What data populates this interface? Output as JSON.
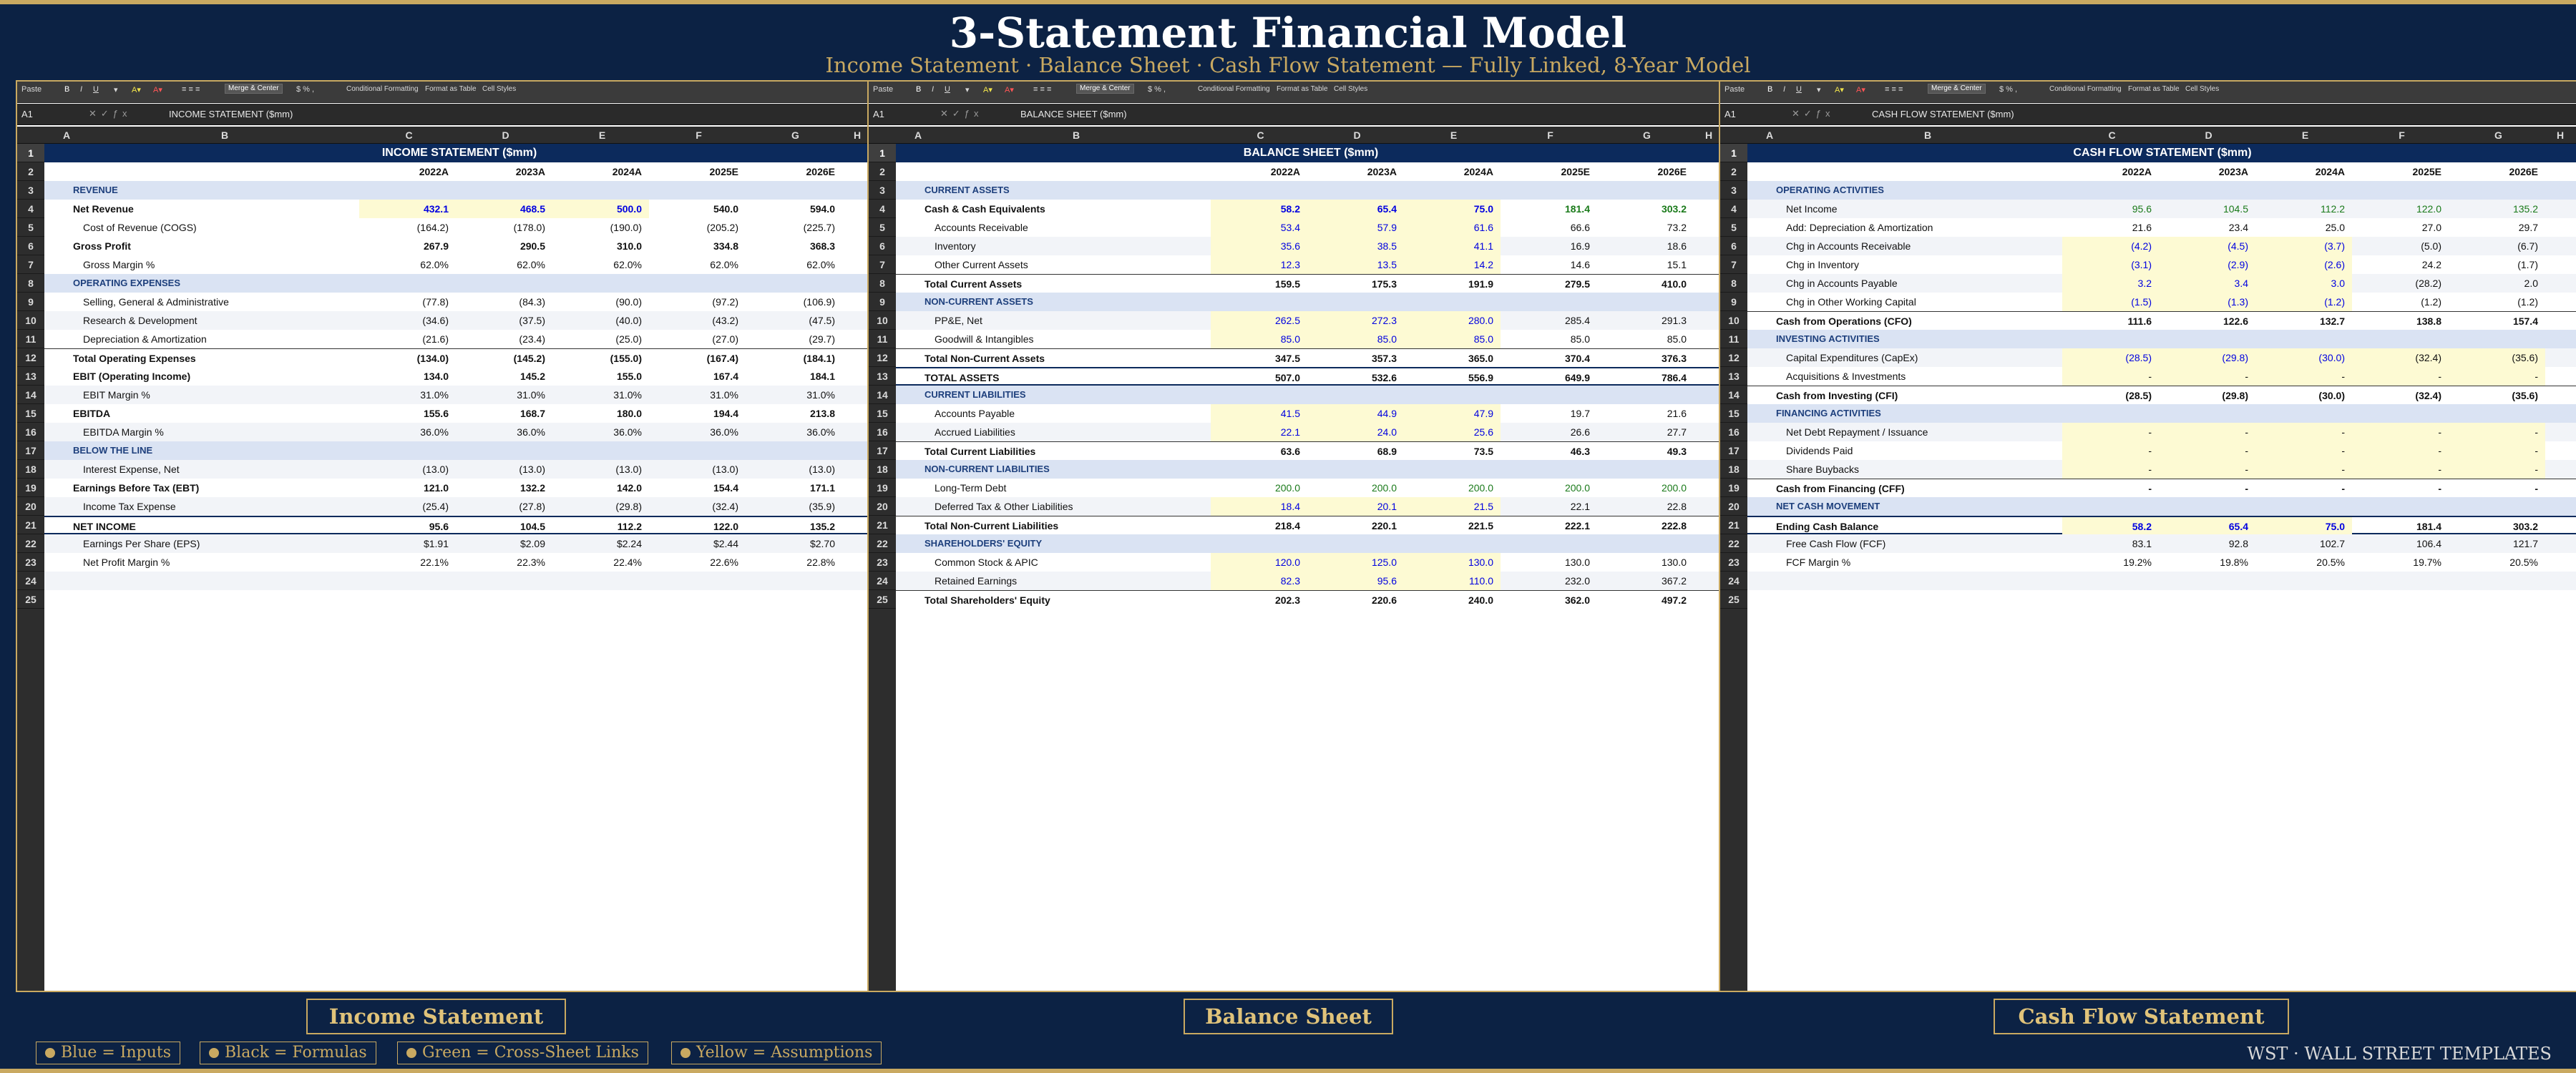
{
  "header": {
    "title": "3-Statement Financial Model",
    "subtitle": "Income Statement  ·  Balance Sheet  ·  Cash Flow Statement  —  Fully Linked, 8-Year Model"
  },
  "ribbon": {
    "paste": "Paste",
    "merge": "Merge & Center",
    "conditional": "Conditional Formatting",
    "format_table": "Format as Table",
    "cell_styles": "Cell Styles"
  },
  "columns": [
    "A",
    "B",
    "C",
    "D",
    "E",
    "F",
    "G"
  ],
  "years": [
    "2022A",
    "2023A",
    "2024A",
    "2025E",
    "2026E"
  ],
  "panels": [
    {
      "cell_ref": "A1",
      "formula": "INCOME STATEMENT ($mm)",
      "sheet_title": "INCOME STATEMENT ($mm)",
      "next_col": "H",
      "rows": [
        {
          "t": "sec",
          "label": "REVENUE"
        },
        {
          "t": "bold",
          "label": "Net Revenue",
          "vals": [
            "432.1",
            "468.5",
            "500.0",
            "540.0",
            "594.0"
          ],
          "c": [
            "inp",
            "inp",
            "inp",
            "",
            ""
          ],
          "y": [
            1,
            1,
            1,
            0,
            0
          ]
        },
        {
          "t": "ind",
          "label": "Cost of Revenue (COGS)",
          "vals": [
            "(164.2)",
            "(178.0)",
            "(190.0)",
            "(205.2)",
            "(225.7)"
          ]
        },
        {
          "t": "bold",
          "label": "Gross Profit",
          "vals": [
            "267.9",
            "290.5",
            "310.0",
            "334.8",
            "368.3"
          ]
        },
        {
          "t": "ind",
          "label": "Gross Margin %",
          "vals": [
            "62.0%",
            "62.0%",
            "62.0%",
            "62.0%",
            "62.0%"
          ]
        },
        {
          "t": "sec",
          "label": "OPERATING EXPENSES"
        },
        {
          "t": "ind",
          "label": "Selling, General & Administrative",
          "vals": [
            "(77.8)",
            "(84.3)",
            "(90.0)",
            "(97.2)",
            "(106.9)"
          ]
        },
        {
          "t": "ind",
          "label": "Research & Development",
          "vals": [
            "(34.6)",
            "(37.5)",
            "(40.0)",
            "(43.2)",
            "(47.5)"
          ]
        },
        {
          "t": "ind",
          "label": "Depreciation & Amortization",
          "vals": [
            "(21.6)",
            "(23.4)",
            "(25.0)",
            "(27.0)",
            "(29.7)"
          ]
        },
        {
          "t": "tot",
          "label": "Total Operating Expenses",
          "vals": [
            "(134.0)",
            "(145.2)",
            "(155.0)",
            "(167.4)",
            "(184.1)"
          ]
        },
        {
          "t": "bold",
          "label": "EBIT (Operating Income)",
          "vals": [
            "134.0",
            "145.2",
            "155.0",
            "167.4",
            "184.1"
          ]
        },
        {
          "t": "ind",
          "label": "EBIT Margin %",
          "vals": [
            "31.0%",
            "31.0%",
            "31.0%",
            "31.0%",
            "31.0%"
          ]
        },
        {
          "t": "bold",
          "label": "EBITDA",
          "vals": [
            "155.6",
            "168.7",
            "180.0",
            "194.4",
            "213.8"
          ]
        },
        {
          "t": "ind",
          "label": "EBITDA Margin %",
          "vals": [
            "36.0%",
            "36.0%",
            "36.0%",
            "36.0%",
            "36.0%"
          ]
        },
        {
          "t": "sec",
          "label": "BELOW THE LINE"
        },
        {
          "t": "ind",
          "label": "Interest Expense, Net",
          "vals": [
            "(13.0)",
            "(13.0)",
            "(13.0)",
            "(13.0)",
            "(13.0)"
          ]
        },
        {
          "t": "bold",
          "label": "Earnings Before Tax (EBT)",
          "vals": [
            "121.0",
            "132.2",
            "142.0",
            "154.4",
            "171.1"
          ]
        },
        {
          "t": "ind",
          "label": "Income Tax Expense",
          "vals": [
            "(25.4)",
            "(27.8)",
            "(29.8)",
            "(32.4)",
            "(35.9)"
          ]
        },
        {
          "t": "grand",
          "label": "NET INCOME",
          "vals": [
            "95.6",
            "104.5",
            "112.2",
            "122.0",
            "135.2"
          ]
        },
        {
          "t": "ind",
          "label": "Earnings Per Share (EPS)",
          "vals": [
            "$1.91",
            "$2.09",
            "$2.24",
            "$2.44",
            "$2.70"
          ]
        },
        {
          "t": "ind",
          "label": "Net Profit Margin %",
          "vals": [
            "22.1%",
            "22.3%",
            "22.4%",
            "22.6%",
            "22.8%"
          ]
        },
        {
          "t": "blank",
          "label": ""
        },
        {
          "t": "blank",
          "label": ""
        }
      ]
    },
    {
      "cell_ref": "A1",
      "formula": "BALANCE SHEET ($mm)",
      "sheet_title": "BALANCE SHEET ($mm)",
      "next_col": "H",
      "rows": [
        {
          "t": "sec",
          "label": "CURRENT ASSETS"
        },
        {
          "t": "bold",
          "label": "Cash & Cash Equivalents",
          "vals": [
            "58.2",
            "65.4",
            "75.0",
            "181.4",
            "303.2"
          ],
          "c": [
            "inp",
            "inp",
            "inp",
            "lnk",
            "lnk"
          ],
          "y": [
            1,
            1,
            1,
            0,
            0
          ]
        },
        {
          "t": "ind",
          "label": "Accounts Receivable",
          "vals": [
            "53.4",
            "57.9",
            "61.6",
            "66.6",
            "73.2"
          ],
          "c": [
            "inp",
            "inp",
            "inp",
            "",
            ""
          ],
          "y": [
            1,
            1,
            1,
            0,
            0
          ]
        },
        {
          "t": "ind",
          "label": "Inventory",
          "vals": [
            "35.6",
            "38.5",
            "41.1",
            "16.9",
            "18.6"
          ],
          "c": [
            "inp",
            "inp",
            "inp",
            "",
            ""
          ],
          "y": [
            1,
            1,
            1,
            0,
            0
          ]
        },
        {
          "t": "ind",
          "label": "Other Current Assets",
          "vals": [
            "12.3",
            "13.5",
            "14.2",
            "14.6",
            "15.1"
          ],
          "c": [
            "inp",
            "inp",
            "inp",
            "",
            ""
          ],
          "y": [
            1,
            1,
            1,
            0,
            0
          ]
        },
        {
          "t": "tot",
          "label": "Total Current Assets",
          "vals": [
            "159.5",
            "175.3",
            "191.9",
            "279.5",
            "410.0"
          ]
        },
        {
          "t": "sec",
          "label": "NON-CURRENT ASSETS"
        },
        {
          "t": "ind",
          "label": "PP&E, Net",
          "vals": [
            "262.5",
            "272.3",
            "280.0",
            "285.4",
            "291.3"
          ],
          "c": [
            "inp",
            "inp",
            "inp",
            "",
            ""
          ],
          "y": [
            1,
            1,
            1,
            0,
            0
          ]
        },
        {
          "t": "ind",
          "label": "Goodwill & Intangibles",
          "vals": [
            "85.0",
            "85.0",
            "85.0",
            "85.0",
            "85.0"
          ],
          "c": [
            "inp",
            "inp",
            "inp",
            "",
            ""
          ],
          "y": [
            1,
            1,
            1,
            0,
            0
          ]
        },
        {
          "t": "tot",
          "label": "Total Non-Current Assets",
          "vals": [
            "347.5",
            "357.3",
            "365.0",
            "370.4",
            "376.3"
          ]
        },
        {
          "t": "grand",
          "label": "TOTAL ASSETS",
          "vals": [
            "507.0",
            "532.6",
            "556.9",
            "649.9",
            "786.4"
          ]
        },
        {
          "t": "sec",
          "label": "CURRENT LIABILITIES"
        },
        {
          "t": "ind",
          "label": "Accounts Payable",
          "vals": [
            "41.5",
            "44.9",
            "47.9",
            "19.7",
            "21.6"
          ],
          "c": [
            "inp",
            "inp",
            "inp",
            "",
            ""
          ],
          "y": [
            1,
            1,
            1,
            0,
            0
          ]
        },
        {
          "t": "ind",
          "label": "Accrued Liabilities",
          "vals": [
            "22.1",
            "24.0",
            "25.6",
            "26.6",
            "27.7"
          ],
          "c": [
            "inp",
            "inp",
            "inp",
            "",
            ""
          ],
          "y": [
            1,
            1,
            1,
            0,
            0
          ]
        },
        {
          "t": "tot",
          "label": "Total Current Liabilities",
          "vals": [
            "63.6",
            "68.9",
            "73.5",
            "46.3",
            "49.3"
          ]
        },
        {
          "t": "sec",
          "label": "NON-CURRENT LIABILITIES"
        },
        {
          "t": "ind",
          "label": "Long-Term Debt",
          "vals": [
            "200.0",
            "200.0",
            "200.0",
            "200.0",
            "200.0"
          ],
          "c": [
            "lnk",
            "lnk",
            "lnk",
            "lnk",
            "lnk"
          ]
        },
        {
          "t": "ind",
          "label": "Deferred Tax & Other Liabilities",
          "vals": [
            "18.4",
            "20.1",
            "21.5",
            "22.1",
            "22.8"
          ],
          "c": [
            "inp",
            "inp",
            "inp",
            "",
            ""
          ],
          "y": [
            1,
            1,
            1,
            0,
            0
          ]
        },
        {
          "t": "tot",
          "label": "Total Non-Current Liabilities",
          "vals": [
            "218.4",
            "220.1",
            "221.5",
            "222.1",
            "222.8"
          ]
        },
        {
          "t": "sec",
          "label": "SHAREHOLDERS' EQUITY"
        },
        {
          "t": "ind",
          "label": "Common Stock & APIC",
          "vals": [
            "120.0",
            "125.0",
            "130.0",
            "130.0",
            "130.0"
          ],
          "c": [
            "inp",
            "inp",
            "inp",
            "",
            ""
          ],
          "y": [
            1,
            1,
            1,
            0,
            0
          ]
        },
        {
          "t": "ind",
          "label": "Retained Earnings",
          "vals": [
            "82.3",
            "95.6",
            "110.0",
            "232.0",
            "367.2"
          ],
          "c": [
            "inp",
            "inp",
            "inp",
            "",
            ""
          ],
          "y": [
            1,
            1,
            1,
            0,
            0
          ]
        },
        {
          "t": "tot",
          "label": "Total Shareholders' Equity",
          "vals": [
            "202.3",
            "220.6",
            "240.0",
            "362.0",
            "497.2"
          ]
        }
      ]
    },
    {
      "cell_ref": "A1",
      "formula": "CASH FLOW STATEMENT ($mm)",
      "sheet_title": "CASH FLOW STATEMENT ($mm)",
      "next_col": "H",
      "rows": [
        {
          "t": "sec",
          "label": "OPERATING ACTIVITIES"
        },
        {
          "t": "ind",
          "label": "Net Income",
          "vals": [
            "95.6",
            "104.5",
            "112.2",
            "122.0",
            "135.2"
          ],
          "c": [
            "lnk",
            "lnk",
            "lnk",
            "lnk",
            "lnk"
          ]
        },
        {
          "t": "ind",
          "label": "Add: Depreciation & Amortization",
          "vals": [
            "21.6",
            "23.4",
            "25.0",
            "27.0",
            "29.7"
          ]
        },
        {
          "t": "ind",
          "label": "Chg in Accounts Receivable",
          "vals": [
            "(4.2)",
            "(4.5)",
            "(3.7)",
            "(5.0)",
            "(6.7)"
          ],
          "c": [
            "inp",
            "inp",
            "inp",
            "",
            ""
          ],
          "y": [
            1,
            1,
            1,
            0,
            0
          ]
        },
        {
          "t": "ind",
          "label": "Chg in Inventory",
          "vals": [
            "(3.1)",
            "(2.9)",
            "(2.6)",
            "24.2",
            "(1.7)"
          ],
          "c": [
            "inp",
            "inp",
            "inp",
            "",
            ""
          ],
          "y": [
            1,
            1,
            1,
            0,
            0
          ]
        },
        {
          "t": "ind",
          "label": "Chg in Accounts Payable",
          "vals": [
            "3.2",
            "3.4",
            "3.0",
            "(28.2)",
            "2.0"
          ],
          "c": [
            "inp",
            "inp",
            "inp",
            "",
            ""
          ],
          "y": [
            1,
            1,
            1,
            0,
            0
          ]
        },
        {
          "t": "ind",
          "label": "Chg in Other Working Capital",
          "vals": [
            "(1.5)",
            "(1.3)",
            "(1.2)",
            "(1.2)",
            "(1.2)"
          ],
          "c": [
            "inp",
            "inp",
            "inp",
            "",
            ""
          ],
          "y": [
            1,
            1,
            1,
            0,
            0
          ]
        },
        {
          "t": "tot",
          "label": "Cash from Operations (CFO)",
          "vals": [
            "111.6",
            "122.6",
            "132.7",
            "138.8",
            "157.4"
          ]
        },
        {
          "t": "sec",
          "label": "INVESTING ACTIVITIES"
        },
        {
          "t": "ind",
          "label": "Capital Expenditures (CapEx)",
          "vals": [
            "(28.5)",
            "(29.8)",
            "(30.0)",
            "(32.4)",
            "(35.6)"
          ],
          "c": [
            "inp",
            "inp",
            "inp",
            "",
            ""
          ],
          "y": [
            1,
            1,
            1,
            1,
            1
          ]
        },
        {
          "t": "ind",
          "label": "Acquisitions & Investments",
          "vals": [
            "-",
            "-",
            "-",
            "-",
            "-"
          ],
          "y": [
            1,
            1,
            1,
            1,
            1
          ]
        },
        {
          "t": "tot",
          "label": "Cash from Investing (CFI)",
          "vals": [
            "(28.5)",
            "(29.8)",
            "(30.0)",
            "(32.4)",
            "(35.6)"
          ]
        },
        {
          "t": "sec",
          "label": "FINANCING ACTIVITIES"
        },
        {
          "t": "ind",
          "label": "Net Debt Repayment / Issuance",
          "vals": [
            "-",
            "-",
            "-",
            "-",
            "-"
          ],
          "y": [
            1,
            1,
            1,
            1,
            1
          ]
        },
        {
          "t": "ind",
          "label": "Dividends Paid",
          "vals": [
            "-",
            "-",
            "-",
            "-",
            "-"
          ],
          "y": [
            1,
            1,
            1,
            1,
            1
          ]
        },
        {
          "t": "ind",
          "label": "Share Buybacks",
          "vals": [
            "-",
            "-",
            "-",
            "-",
            "-"
          ],
          "y": [
            1,
            1,
            1,
            1,
            1
          ]
        },
        {
          "t": "tot",
          "label": "Cash from Financing (CFF)",
          "vals": [
            "-",
            "-",
            "-",
            "-",
            "-"
          ]
        },
        {
          "t": "sec",
          "label": "NET CASH MOVEMENT"
        },
        {
          "t": "grand",
          "label": "Ending Cash Balance",
          "vals": [
            "58.2",
            "65.4",
            "75.0",
            "181.4",
            "303.2"
          ],
          "c": [
            "inp",
            "inp",
            "inp",
            "",
            ""
          ],
          "y": [
            1,
            1,
            1,
            0,
            0
          ]
        },
        {
          "t": "ind",
          "label": "Free Cash Flow (FCF)",
          "vals": [
            "83.1",
            "92.8",
            "102.7",
            "106.4",
            "121.7"
          ]
        },
        {
          "t": "ind",
          "label": "FCF Margin %",
          "vals": [
            "19.2%",
            "19.8%",
            "20.5%",
            "19.7%",
            "20.5%"
          ]
        },
        {
          "t": "blank",
          "label": ""
        },
        {
          "t": "blank",
          "label": ""
        }
      ]
    }
  ],
  "tabs": [
    "Income Statement",
    "Balance Sheet",
    "Cash Flow Statement"
  ],
  "legend": [
    "Blue = Inputs",
    "Black = Formulas",
    "Green = Cross-Sheet Links",
    "Yellow = Assumptions"
  ],
  "brand": "WST · WALL STREET TEMPLATES",
  "colors": {
    "navy": "#0c2244",
    "gold": "#c9a961",
    "input_blue": "#0000e0",
    "link_green": "#1a7a1a",
    "assumption_yellow": "#fdfad3"
  }
}
